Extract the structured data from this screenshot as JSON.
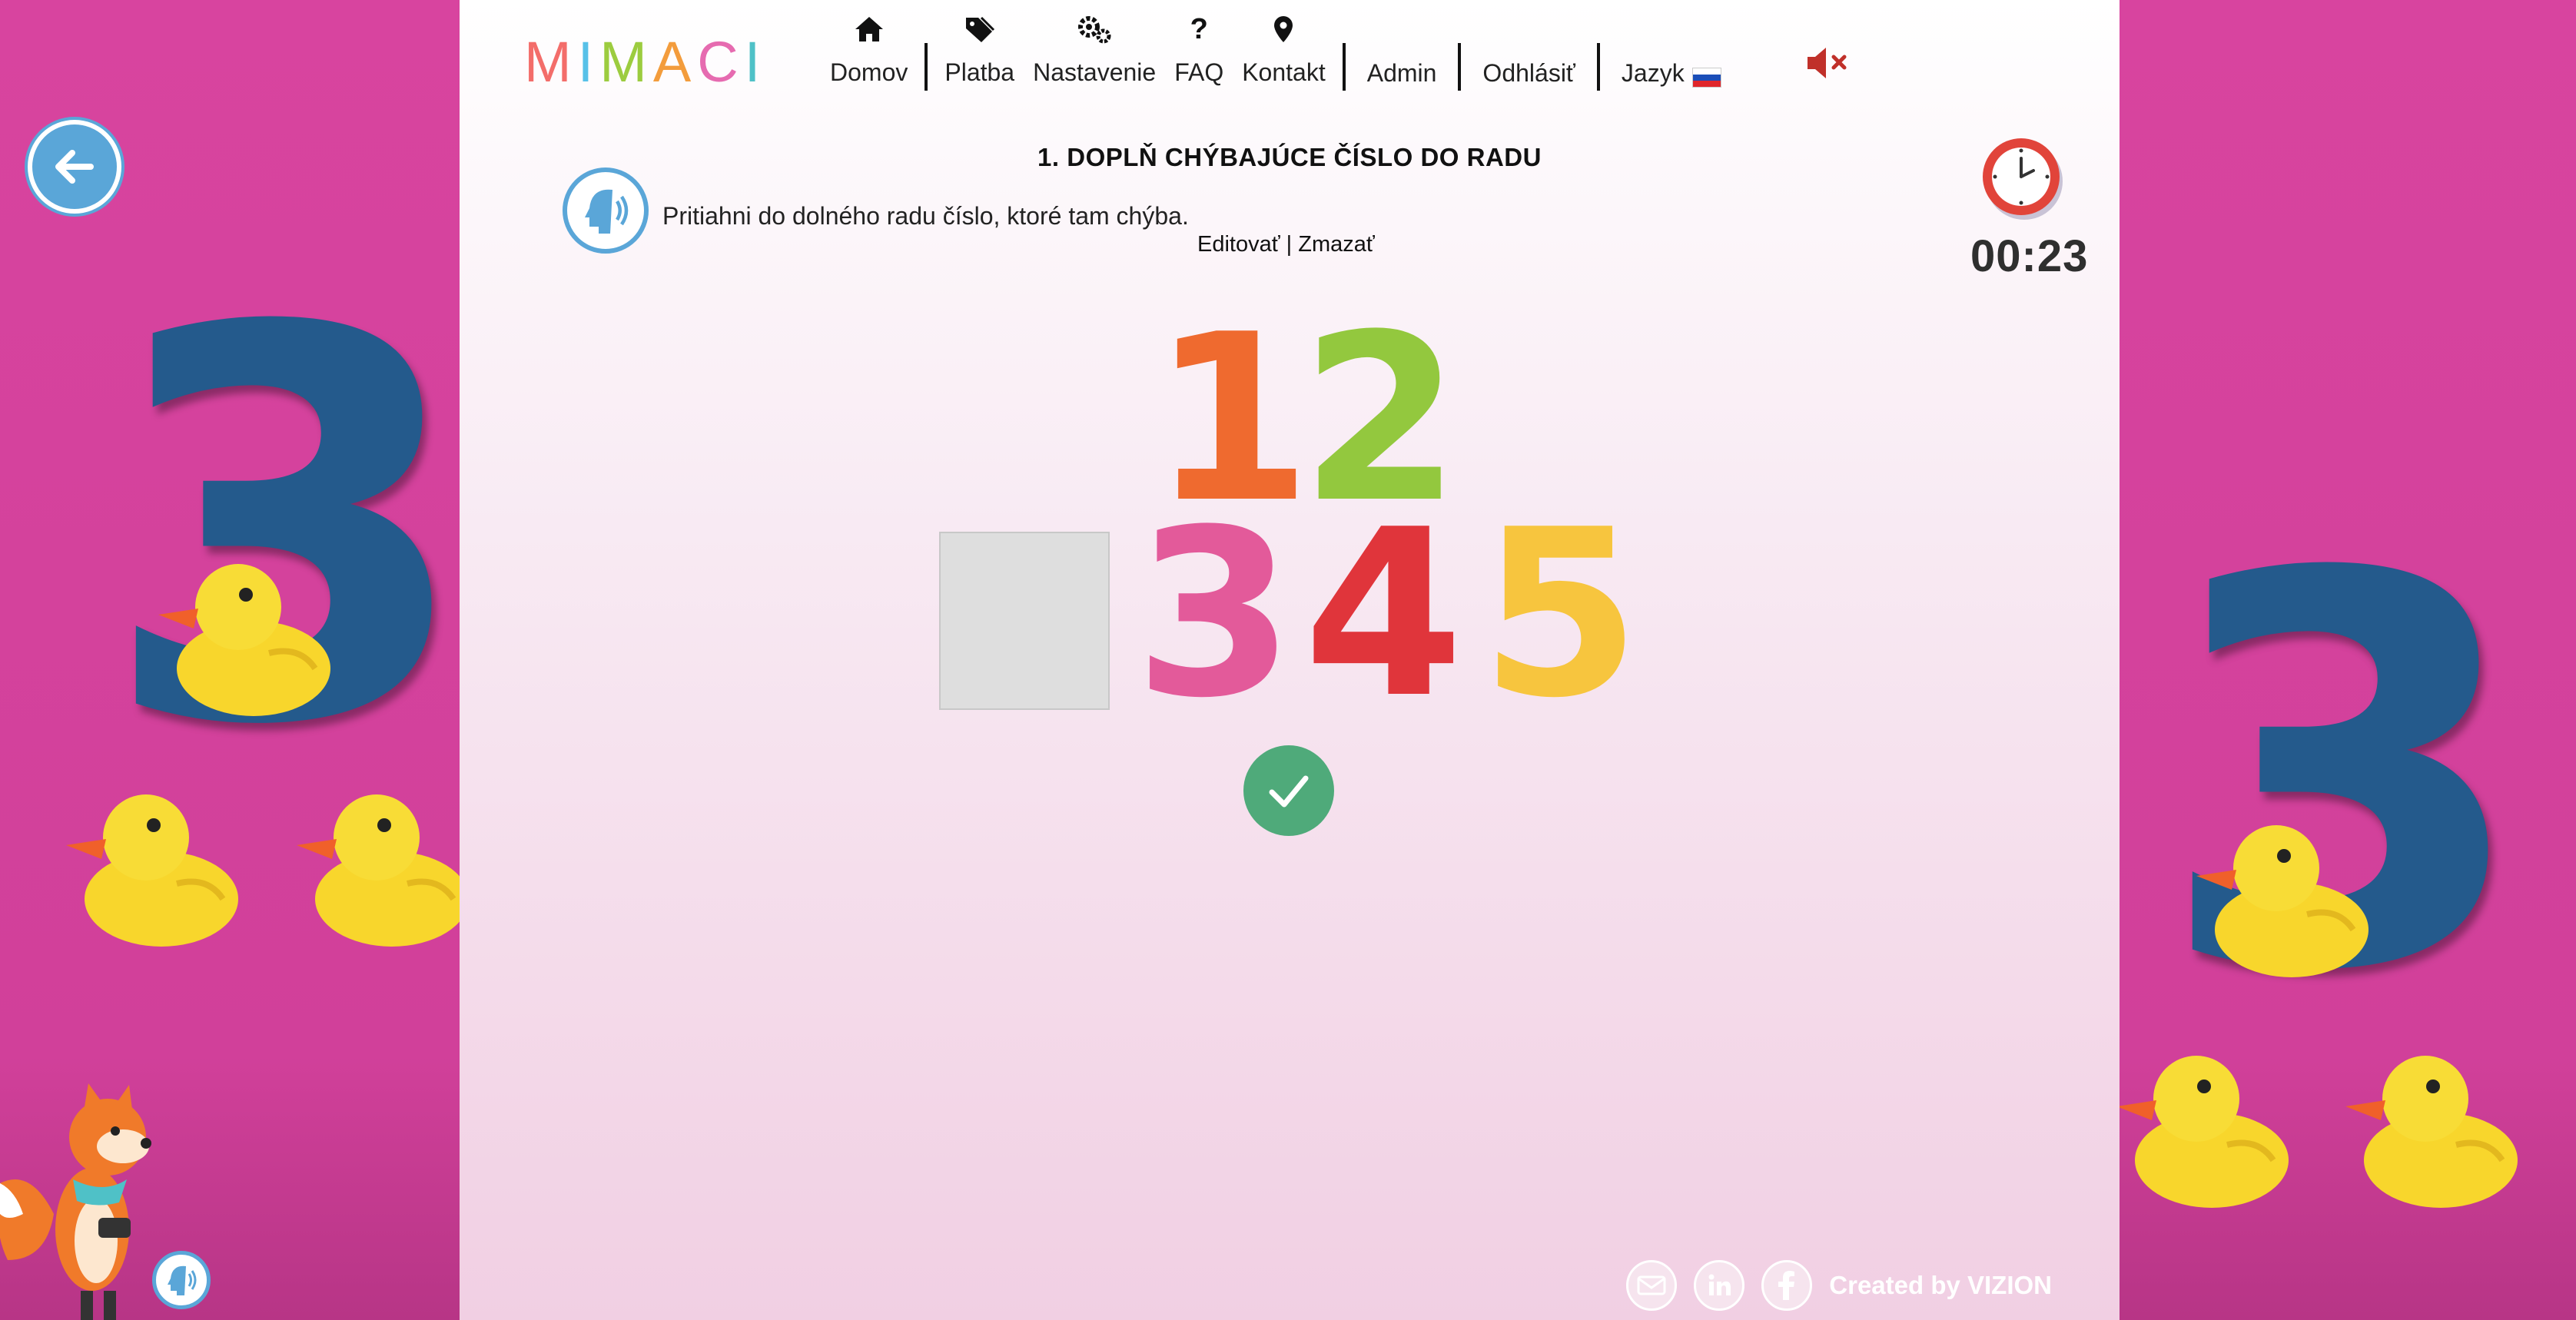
{
  "app": {
    "logo_letters": [
      "M",
      "I",
      "M",
      "A",
      "C",
      "I"
    ],
    "logo_colors": [
      "#f36d6a",
      "#57c1e8",
      "#9ccc3f",
      "#f39c3c",
      "#e66bb0",
      "#4fc1c7"
    ]
  },
  "nav": {
    "home": {
      "label": "Domov",
      "icon": "home-icon"
    },
    "payment": {
      "label": "Platba",
      "icon": "tag-icon"
    },
    "settings": {
      "label": "Nastavenie",
      "icon": "gears-icon"
    },
    "faq": {
      "label": "FAQ",
      "icon": "question-icon"
    },
    "contact": {
      "label": "Kontakt",
      "icon": "map-pin-icon"
    },
    "admin": {
      "label": "Admin"
    },
    "logout": {
      "label": "Odhlásiť"
    },
    "language": {
      "label": "Jazyk",
      "flag": "sk-flag"
    },
    "sound": {
      "icon": "speaker-muted-icon",
      "color": "#c0302a"
    }
  },
  "task": {
    "title": "1. DOPLŇ CHÝBAJÚCE ČÍSLO DO RADU",
    "instruction": "Pritiahni do dolného radu číslo, ktoré tam chýba.",
    "edit_label": "Editovať",
    "divider": "|",
    "delete_label": "Zmazať",
    "timer": "00:23"
  },
  "choices": [
    {
      "value": "1",
      "color": "#ef6a2f"
    },
    {
      "value": "2",
      "color": "#93c83e"
    }
  ],
  "sequence": [
    {
      "value": "",
      "empty": true
    },
    {
      "value": "3",
      "color": "#e35a9a"
    },
    {
      "value": "4",
      "color": "#e0353b"
    },
    {
      "value": "5",
      "color": "#f7c53e"
    }
  ],
  "footer": {
    "credit": "Created by VIZION",
    "social": [
      "mail-icon",
      "linkedin-icon",
      "facebook-icon"
    ]
  },
  "decor": {
    "number": "3",
    "number_color": "#245a8c",
    "accent": "#5aa6d8",
    "check_color": "#4faa7a"
  }
}
